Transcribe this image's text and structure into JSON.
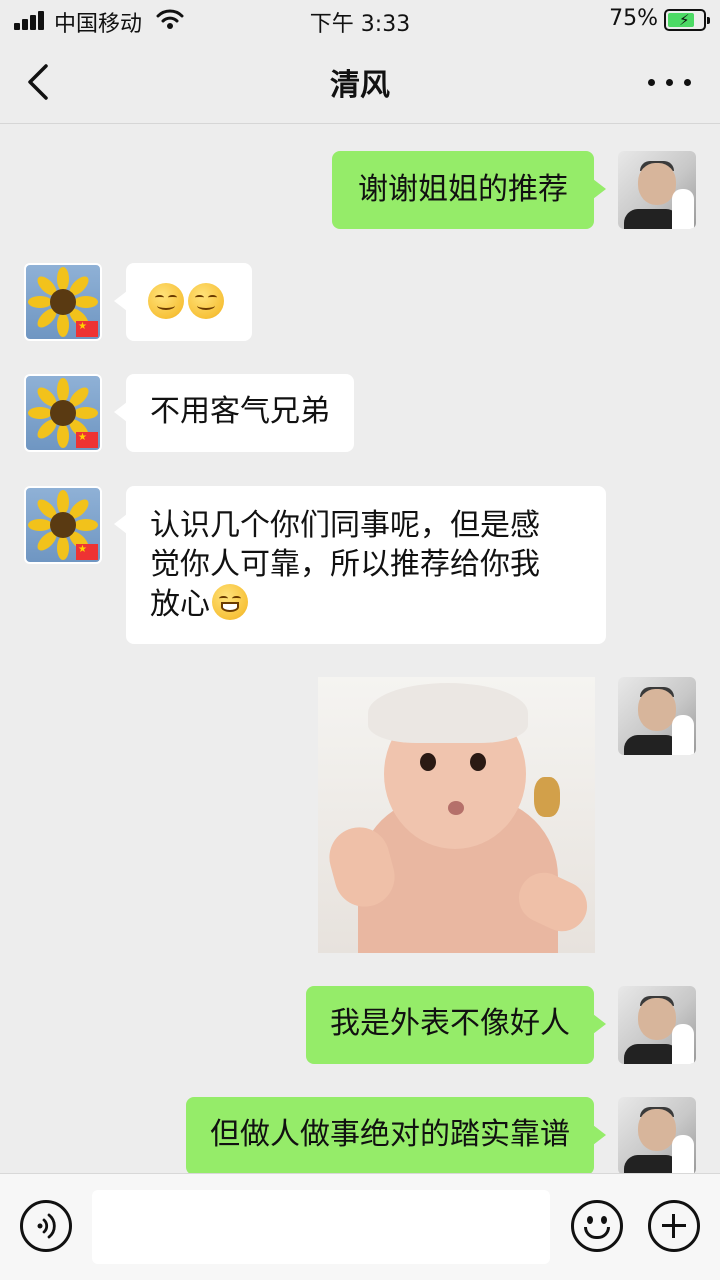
{
  "status_bar": {
    "carrier": "中国移动",
    "time": "下午 3:33",
    "battery_percent": "75%",
    "battery_level": 0.75
  },
  "nav": {
    "title": "清风",
    "back_icon": "chevron-left-icon",
    "more_icon": "more-dots-icon"
  },
  "messages": [
    {
      "from": "me",
      "type": "text",
      "text": "谢谢姐姐的推荐"
    },
    {
      "from": "her",
      "type": "emoji",
      "emoji": [
        "smiling-face",
        "smiling-face"
      ]
    },
    {
      "from": "her",
      "type": "text",
      "text": "不用客气兄弟"
    },
    {
      "from": "her",
      "type": "text",
      "lines": [
        "认识几个你们同事呢，但是感",
        "觉你人可靠，所以推荐给你我",
        "放心"
      ],
      "trailing_emoji": "grinning-face"
    },
    {
      "from": "me",
      "type": "image",
      "image": "baby-photo"
    },
    {
      "from": "me",
      "type": "text",
      "text": "我是外表不像好人"
    },
    {
      "from": "me",
      "type": "text",
      "text": "但做人做事绝对的踏实靠谱"
    }
  ],
  "input_bar": {
    "voice_icon": "voice-icon",
    "placeholder": "",
    "emoji_icon": "emoji-icon",
    "plus_icon": "plus-icon"
  },
  "colors": {
    "background": "#ededed",
    "my_bubble": "#95ec69",
    "her_bubble": "#ffffff",
    "battery_fill": "#4cd964"
  }
}
